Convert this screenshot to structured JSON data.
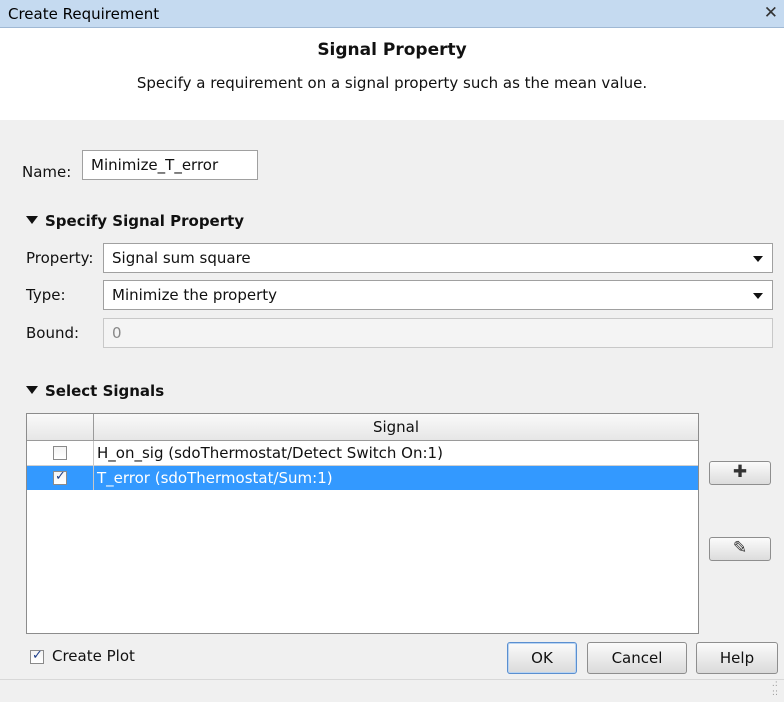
{
  "window": {
    "title": "Create Requirement",
    "close_glyph": "✕"
  },
  "header": {
    "heading": "Signal Property",
    "subheading": "Specify a requirement on a signal property such as the mean value."
  },
  "name": {
    "label": "Name:",
    "value": "Minimize_T_error"
  },
  "specify_section": {
    "title": "Specify Signal Property",
    "property_label": "Property:",
    "property_value": "Signal sum square",
    "type_label": "Type:",
    "type_value": "Minimize the property",
    "bound_label": "Bound:",
    "bound_value": "0"
  },
  "select_section": {
    "title": "Select Signals",
    "column_header": "Signal",
    "rows": [
      {
        "signal": "H_on_sig (sdoThermostat/Detect Switch On:1)",
        "checked": false,
        "selected": false
      },
      {
        "signal": "T_error (sdoThermostat/Sum:1)",
        "checked": true,
        "selected": true
      }
    ],
    "add_icon": "plus-icon",
    "edit_icon": "pencil-icon",
    "add_glyph": "✚",
    "edit_glyph": "✎"
  },
  "footer": {
    "create_plot_label": "Create Plot",
    "create_plot_checked": true,
    "ok_label": "OK",
    "cancel_label": "Cancel",
    "help_label": "Help"
  },
  "colors": {
    "selection": "#3399ff",
    "titlebar": "#c5daf0"
  }
}
